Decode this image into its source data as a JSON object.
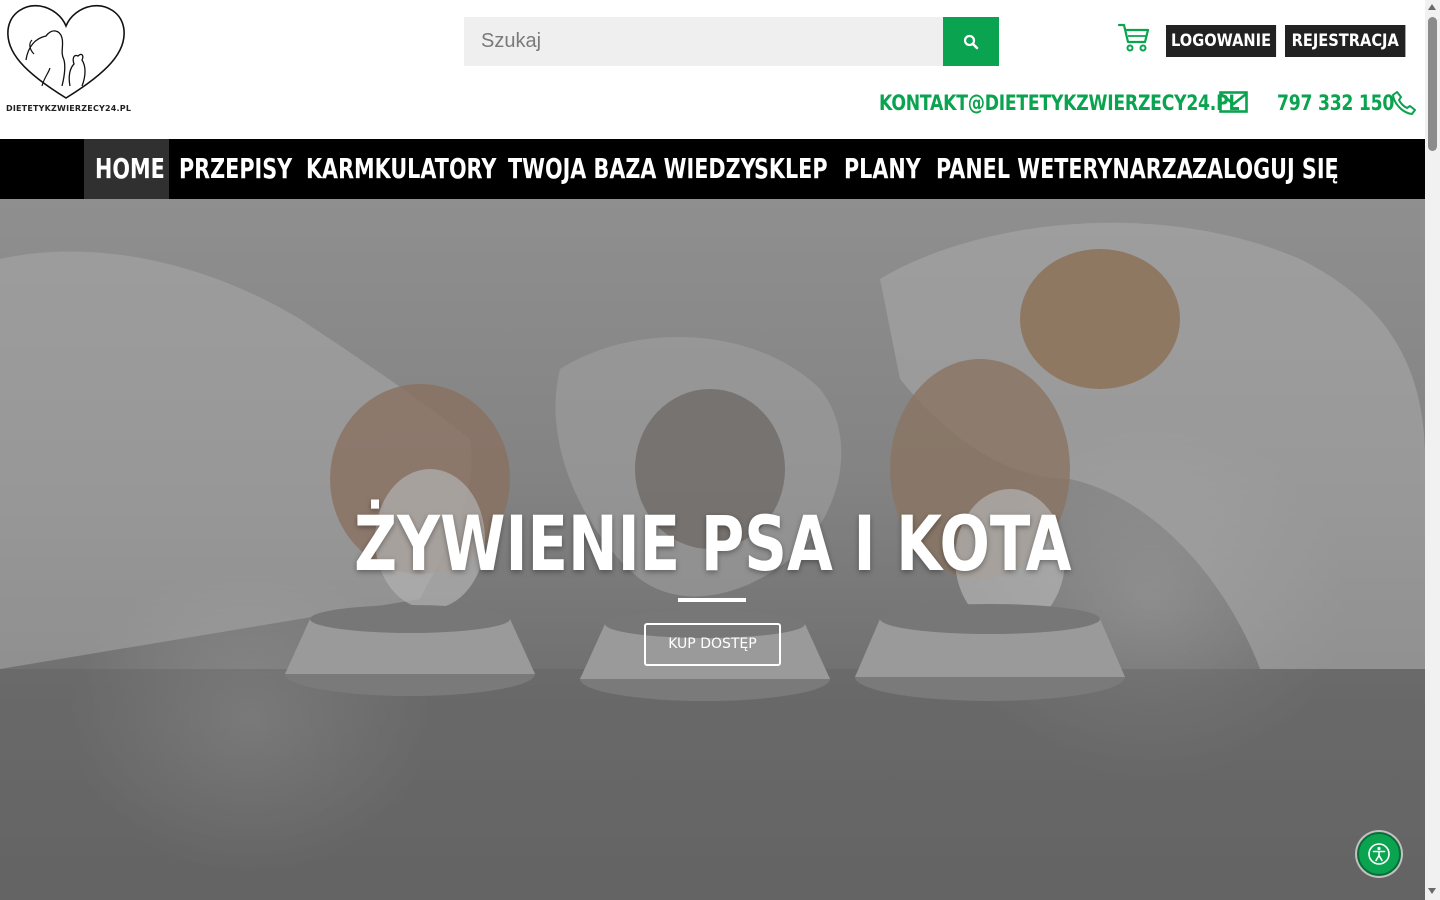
{
  "header": {
    "logo_text": "DIETETYKZWIERZECY24.PL",
    "search": {
      "placeholder": "Szukaj",
      "button_icon": "search-icon"
    },
    "cart_icon": "cart-icon",
    "login_label": "LOGOWANIE",
    "register_label": "REJESTRACJA",
    "email": "KONTAKT@DIETETYKZWIERZECY24.PL",
    "phone": "797 332 150"
  },
  "nav": {
    "items": [
      {
        "label": "HOME",
        "active": true
      },
      {
        "label": "PRZEPISY"
      },
      {
        "label": "KARMKULATORY"
      },
      {
        "label": "TWOJA BAZA WIEDZY"
      },
      {
        "label": "SKLEP"
      },
      {
        "label": "PLANY"
      },
      {
        "label": "PANEL WETERYNARZA"
      },
      {
        "label": "ZALOGUJ SIĘ"
      }
    ]
  },
  "hero": {
    "title": "ŻYWIENIE PSA I KOTA",
    "button_label": "KUP DOSTĘP"
  },
  "colors": {
    "accent": "#0aa34f",
    "dark_button": "#222222",
    "nav_bg": "#000000",
    "nav_active": "#303030"
  }
}
